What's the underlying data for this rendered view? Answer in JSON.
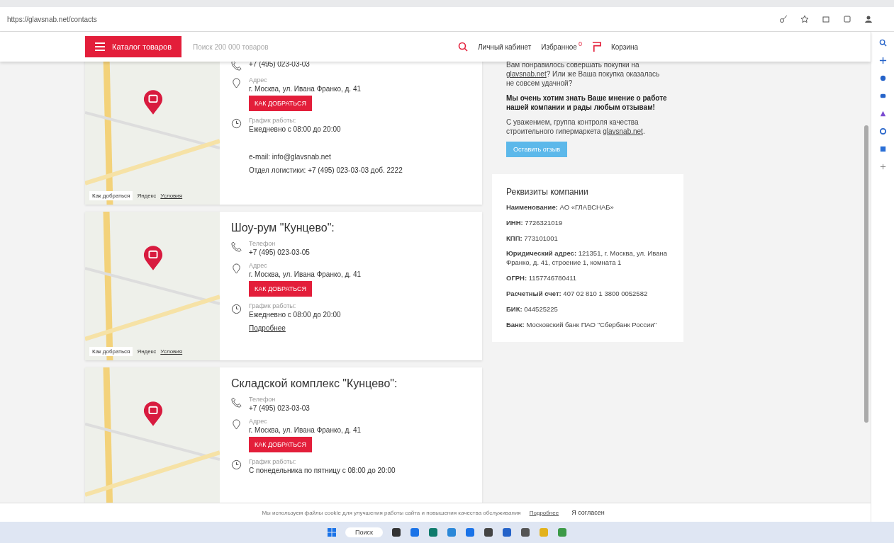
{
  "browser": {
    "url": "https://glavsnab.net/contacts"
  },
  "header": {
    "catalog_button": "Каталог товаров",
    "search_placeholder": "Поиск 200 000 товаров",
    "account": "Личный кабинет",
    "favorites": "Избранное",
    "favorites_count": "0",
    "cart": "Корзина"
  },
  "locations": [
    {
      "phone": "+7 (495) 023-03-03",
      "address_label": "Адрес",
      "address": "г. Москва, ул. Ивана Франко, д. 41",
      "route_button": "КАК ДОБРАТЬСЯ",
      "hours_label": "График работы:",
      "hours": "Ежедневно с 08:00 до 20:00",
      "extra": [
        "e-mail: info@glavsnab.net",
        "Отдел логистики: +7 (495) 023-03-03 доб. 2222"
      ],
      "map_route": "Как добраться",
      "map_brand": "Яндекс",
      "map_terms": "Условия"
    },
    {
      "title": "Шоу-рум \"Кунцево\":",
      "phone_label": "Телефон",
      "phone": "+7 (495) 023-03-05",
      "address_label": "Адрес",
      "address": "г. Москва, ул. Ивана Франко, д. 41",
      "route_button": "КАК ДОБРАТЬСЯ",
      "hours_label": "График работы:",
      "hours": "Ежедневно с 08:00 до 20:00",
      "link": "Подробнее",
      "map_route": "Как добраться",
      "map_brand": "Яндекс",
      "map_terms": "Условия"
    },
    {
      "title": "Складской комплекс \"Кунцево\":",
      "phone_label": "Телефон",
      "phone": "+7 (495) 023-03-03",
      "address_label": "Адрес",
      "address": "г. Москва, ул. Ивана Франко, д. 41",
      "route_button": "КАК ДОБРАТЬСЯ",
      "hours_label": "График работы:",
      "hours": "С понедельника по пятницу с 08:00 до 20:00"
    }
  ],
  "feedback": {
    "intro_before": "Вам понравилось совершать покупки на",
    "intro_link": "glavsnab.net",
    "intro_after": "? Или же Ваша покупка оказалась не совсем удачной?",
    "bold": "Мы очень хотим знать Ваше мнение о работе нашей компании и рады любым отзывам!",
    "signature": "С уважением, группа контроля качества строительного гипермаркета",
    "signature_link": "glavsnab.net",
    "signature_end": ".",
    "button": "Оставить отзыв"
  },
  "requisites": {
    "title": "Реквизиты компании",
    "rows": [
      {
        "label": "Наименование:",
        "value": "АО «ГЛАВСНАБ»"
      },
      {
        "label": "ИНН:",
        "value": "7726321019"
      },
      {
        "label": "КПП:",
        "value": "773101001"
      },
      {
        "label": "Юридический адрес:",
        "value": "121351, г. Москва, ул. Ивана Франко, д. 41, строение 1, комната 1"
      },
      {
        "label": "ОГРН:",
        "value": "1157746780411"
      },
      {
        "label": "Расчетный счет:",
        "value": "407 02 810 1 3800 0052582"
      },
      {
        "label": "БИК:",
        "value": "044525225"
      },
      {
        "label": "Банк:",
        "value": "Московский банк ПАО \"Сбербанк России\""
      }
    ]
  },
  "cookie": {
    "text": "Мы используем файлы cookie для улучшения работы сайта и повышения качества обслуживания",
    "link": "Подробнее",
    "button": "Я согласен"
  },
  "taskbar": {
    "search": "Поиск"
  }
}
